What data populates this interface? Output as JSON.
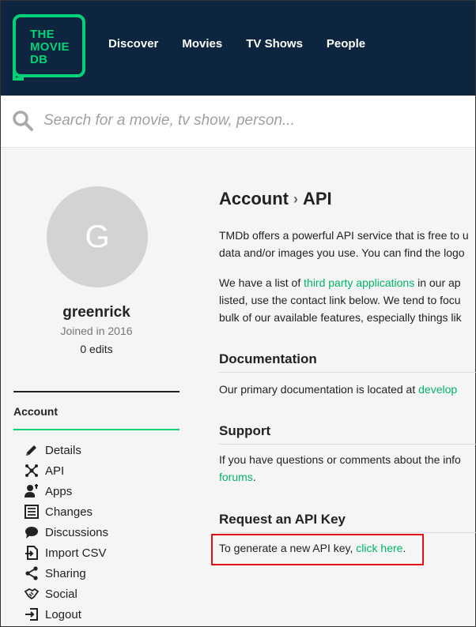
{
  "header": {
    "logo_lines": [
      "THE",
      "MOVIE",
      "DB"
    ],
    "nav": [
      "Discover",
      "Movies",
      "TV Shows",
      "People"
    ]
  },
  "search": {
    "placeholder": "Search for a movie, tv show, person..."
  },
  "profile": {
    "initial": "G",
    "username": "greenrick",
    "joined": "Joined in 2016",
    "edits": "0 edits"
  },
  "sidebar": {
    "section_label": "Account",
    "items": [
      {
        "label": "Details",
        "icon": "pencil-icon"
      },
      {
        "label": "API",
        "icon": "api-icon"
      },
      {
        "label": "Apps",
        "icon": "user-key-icon"
      },
      {
        "label": "Changes",
        "icon": "list-icon"
      },
      {
        "label": "Discussions",
        "icon": "chat-bubble-icon"
      },
      {
        "label": "Import CSV",
        "icon": "import-file-icon"
      },
      {
        "label": "Sharing",
        "icon": "share-icon"
      },
      {
        "label": "Social",
        "icon": "handshake-icon"
      },
      {
        "label": "Logout",
        "icon": "logout-icon"
      }
    ]
  },
  "main": {
    "breadcrumb": {
      "first": "Account",
      "separator": "›",
      "second": "API"
    },
    "intro": {
      "line1": "TMDb offers a powerful API service that is free to u",
      "line2": "data and/or images you use. You can find the logo"
    },
    "apps_para": {
      "line1_pre": "We have a list of ",
      "line1_link": "third party applications",
      "line1_post": " in our ap",
      "line2": "listed, use the contact link below. We tend to focu",
      "line3": "bulk of our available features, especially things lik"
    },
    "documentation": {
      "heading": "Documentation",
      "text": "Our primary documentation is located at ",
      "link": "develop"
    },
    "support": {
      "heading": "Support",
      "text": "If you have questions or comments about the info",
      "link": "forums",
      "after": "."
    },
    "request": {
      "heading": "Request an API Key",
      "text": "To generate a new API key, ",
      "link": "click here",
      "after": "."
    }
  },
  "colors": {
    "header_bg": "#0d253f",
    "brand_green": "#01d277",
    "highlight_red": "#e0101a"
  }
}
